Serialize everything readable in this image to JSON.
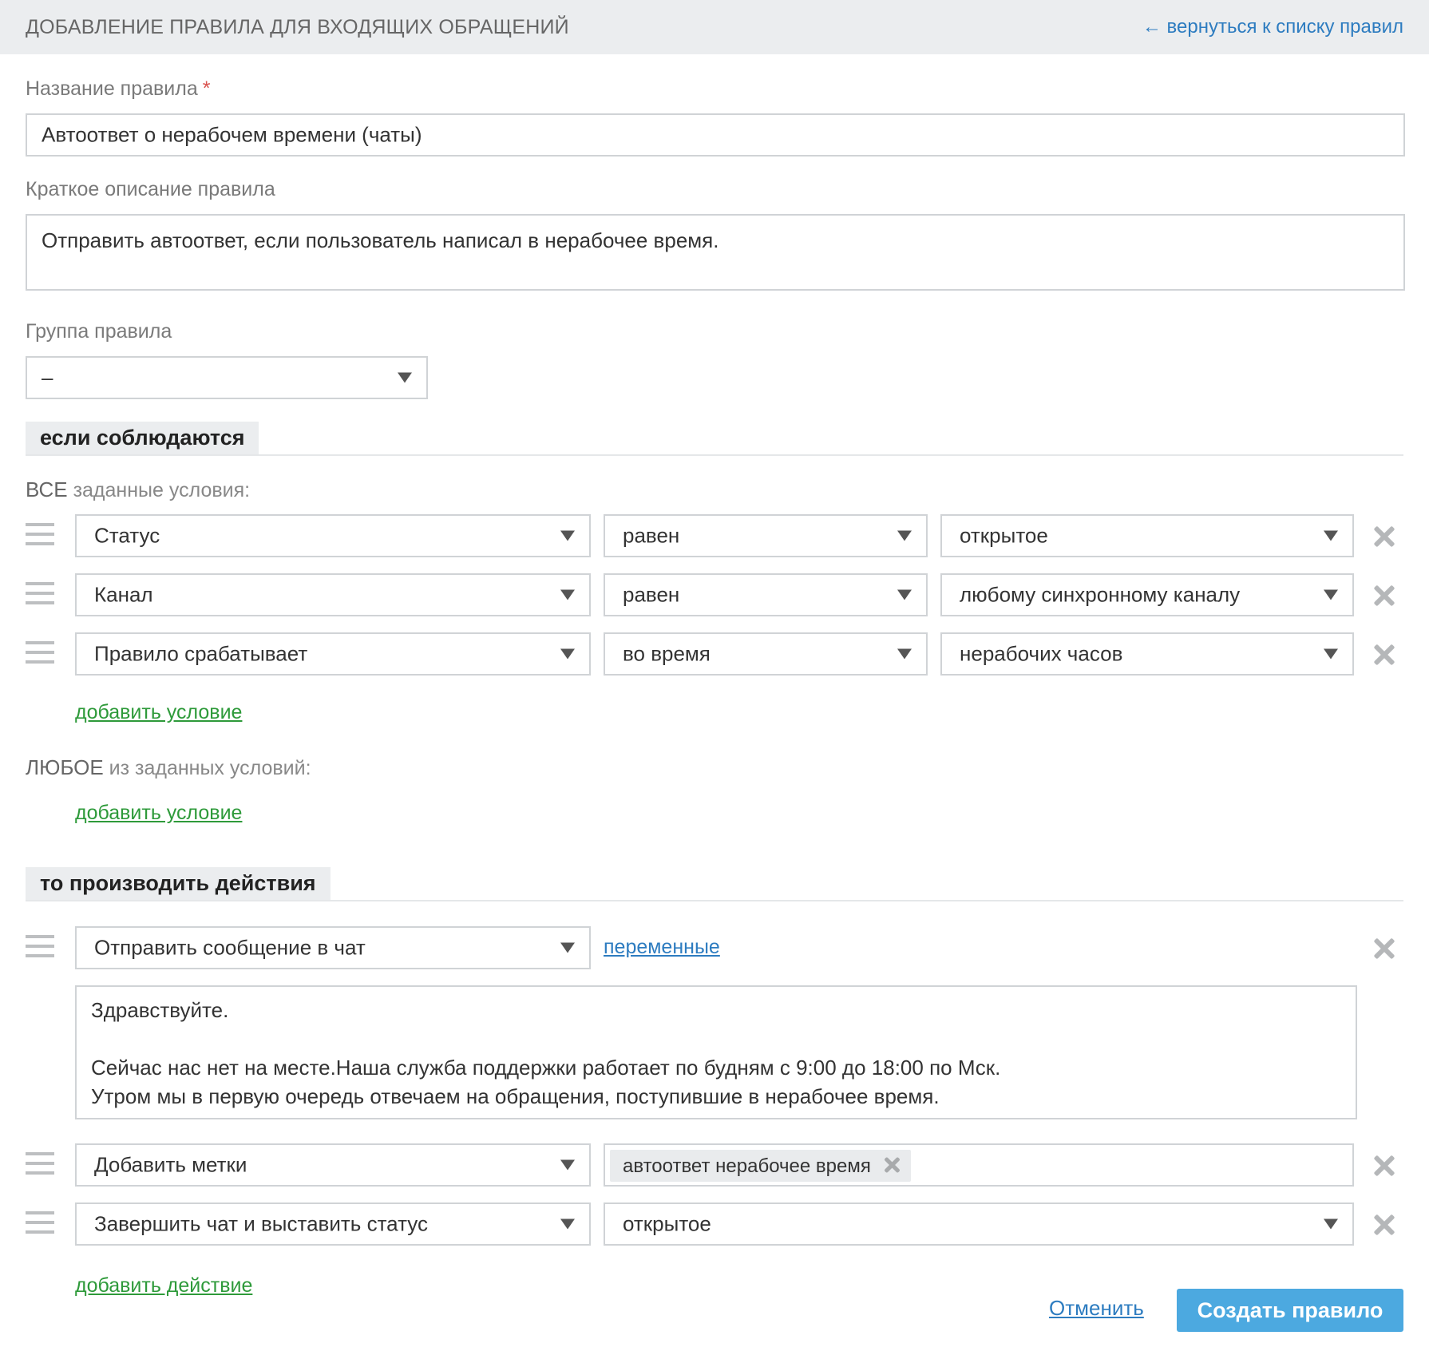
{
  "header": {
    "title": "ДОБАВЛЕНИЕ ПРАВИЛА ДЛЯ ВХОДЯЩИХ ОБРАЩЕНИЙ",
    "back_link": "← вернуться к списку правил"
  },
  "form": {
    "name_label": "Название правила",
    "required_mark": "*",
    "name_value": "Автоответ о нерабочем времени (чаты)",
    "desc_label": "Краткое описание правила",
    "desc_value": "Отправить автоответ, если пользователь написал в нерабочее время.",
    "group_label": "Группа правила",
    "group_value": "–"
  },
  "conditions": {
    "section_title": "если соблюдаются",
    "all_keyword": "ВСЕ",
    "all_rest": "заданные условия:",
    "rows": [
      {
        "field": "Статус",
        "operator": "равен",
        "value": "открытое"
      },
      {
        "field": "Канал",
        "operator": "равен",
        "value": "любому синхронному каналу"
      },
      {
        "field": "Правило срабатывает",
        "operator": "во время",
        "value": "нерабочих часов"
      }
    ],
    "add_condition": "добавить условие",
    "any_keyword": "ЛЮБОЕ",
    "any_rest": "из заданных условий:",
    "add_condition_any": "добавить условие"
  },
  "actions": {
    "section_title": "то производить действия",
    "send_message": {
      "type": "Отправить сообщение в чат",
      "variables_link": "переменные",
      "lines": [
        "Здравствуйте.",
        "Сейчас нас нет на месте.Наша служба поддержки работает по будням с 9:00 до 18:00 по Мск.",
        "Утром мы в первую очередь отвечаем на обращения, поступившие в нерабочее время."
      ]
    },
    "add_tags": {
      "type": "Добавить метки",
      "tag": "автоответ нерабочее время"
    },
    "close_chat": {
      "type": "Завершить чат и выставить статус",
      "value": "открытое"
    },
    "add_action": "добавить действие"
  },
  "footer": {
    "cancel": "Отменить",
    "create": "Создать правило"
  }
}
